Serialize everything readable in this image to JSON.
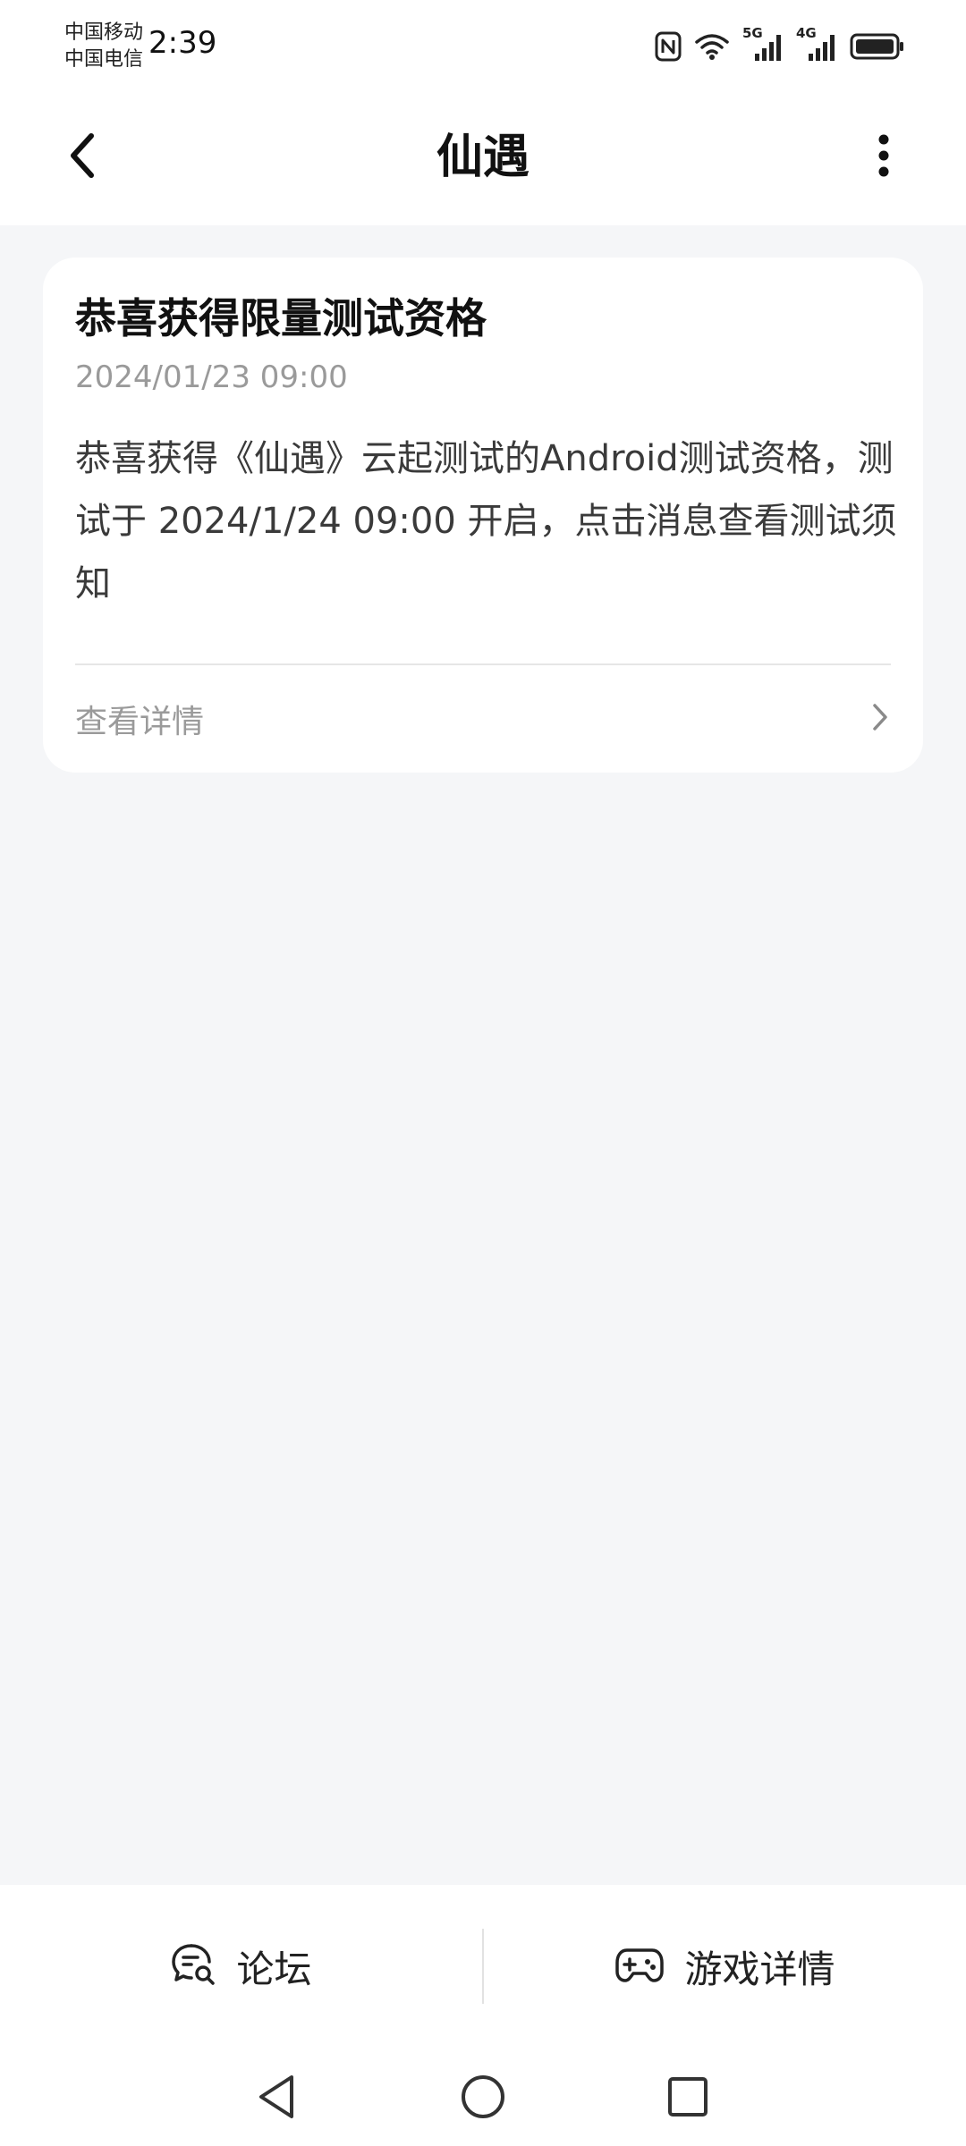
{
  "status_bar": {
    "carrier_1": "中国移动",
    "carrier_2": "中国电信",
    "time": "2:39",
    "icons": [
      "nfc-icon",
      "wifi-icon",
      "signal-5g-icon",
      "signal-4g-icon",
      "battery-icon"
    ],
    "signal_1_label": "5G",
    "signal_2_label": "4G"
  },
  "header": {
    "title": "仙遇",
    "back_icon": "chevron-left-icon",
    "more_icon": "more-vertical-icon"
  },
  "message": {
    "title": "恭喜获得限量测试资格",
    "timestamp": "2024/01/23 09:00",
    "body": "恭喜获得《仙遇》云起测试的Android测试资格，测试于 2024/1/24 09:00 开启，点击消息查看测试须知",
    "link_label": "查看详情",
    "link_icon": "chevron-right-icon"
  },
  "bottom_bar": {
    "forum_label": "论坛",
    "forum_icon": "chat-search-icon",
    "game_label": "游戏详情",
    "game_icon": "gamepad-icon"
  },
  "nav": {
    "back_icon": "nav-back-icon",
    "home_icon": "nav-home-icon",
    "recents_icon": "nav-recents-icon"
  },
  "colors": {
    "background": "#f5f6f8",
    "surface": "#ffffff",
    "text_primary": "#111111",
    "text_secondary": "#9a9a9a"
  }
}
